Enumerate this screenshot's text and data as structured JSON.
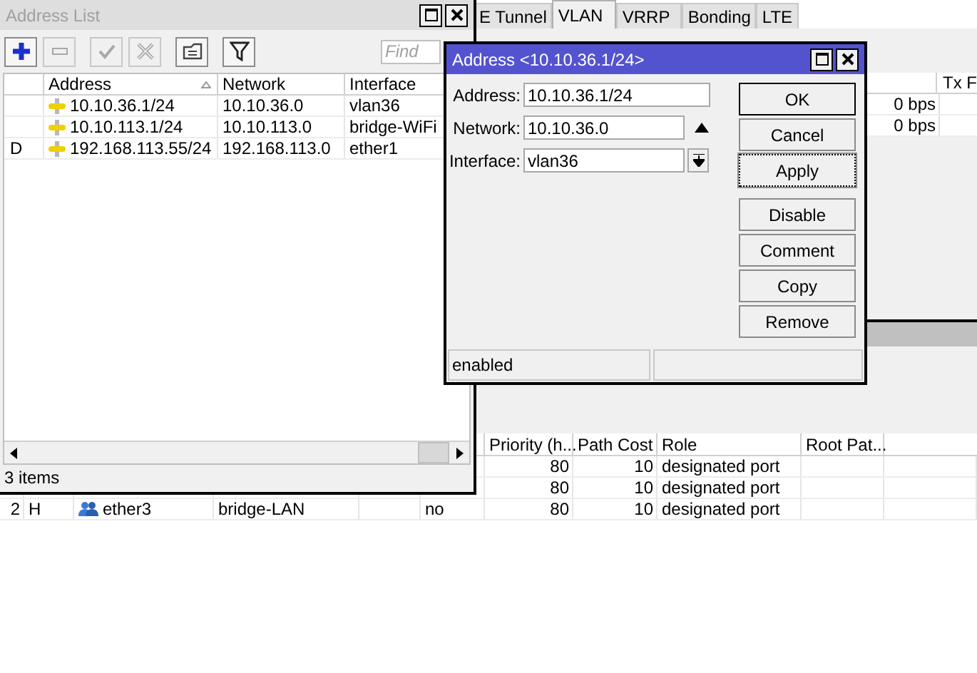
{
  "main_window": {
    "tabs": [
      {
        "label": "E Tunnel",
        "selected": false
      },
      {
        "label": "VLAN",
        "selected": true
      },
      {
        "label": "VRRP",
        "selected": false
      },
      {
        "label": "Bonding",
        "selected": false
      },
      {
        "label": "LTE",
        "selected": false
      }
    ],
    "upper_table": {
      "column": "Tx F",
      "rows": [
        {
          "rate": "0 bps"
        },
        {
          "rate": "0 bps"
        }
      ]
    },
    "lower_table": {
      "columns": [
        "Priority (h...",
        "Path Cost",
        "Role",
        "Root Pat..."
      ],
      "rows": [
        {
          "priority": "80",
          "path_cost": "10",
          "role": "designated port"
        },
        {
          "priority": "80",
          "path_cost": "10",
          "role": "designated port"
        },
        {
          "number": "2",
          "flag": "H",
          "interface": "ether3",
          "bridge": "bridge-LAN",
          "column_6": "no",
          "priority": "80",
          "path_cost": "10",
          "role": "designated port"
        }
      ]
    }
  },
  "address_list": {
    "title": "Address List",
    "active": false,
    "toolbar": [
      {
        "kind": "add",
        "disabled": false
      },
      {
        "kind": "remove",
        "disabled": true
      },
      {
        "kind": "enable",
        "disabled": true
      },
      {
        "kind": "disable",
        "disabled": true
      },
      {
        "kind": "comment",
        "disabled": false
      },
      {
        "kind": "filter",
        "disabled": false
      }
    ],
    "find": {
      "placeholder": "Find"
    },
    "columns": [
      {
        "label": "Address",
        "sorted": true
      },
      {
        "label": "Network",
        "sorted": false
      },
      {
        "label": "Interface",
        "sorted": false
      }
    ],
    "rows": [
      {
        "address": "10.10.36.1/24",
        "network": "10.10.36.0",
        "interface": "vlan36"
      },
      {
        "address": "10.10.113.1/24",
        "network": "10.10.113.0",
        "interface": "bridge-WiFi"
      },
      {
        "flag": "D",
        "address": "192.168.113.55/24",
        "network": "192.168.113.0",
        "interface": "ether1"
      }
    ],
    "status": "3 items"
  },
  "address_dialog": {
    "title": "Address <10.10.36.1/24>",
    "active": true,
    "fields": [
      {
        "label": "Address:",
        "value": "10.10.36.1/24",
        "kind": "text"
      },
      {
        "label": "Network:",
        "value": "10.10.36.0",
        "kind": "spin"
      },
      {
        "label": "Interface:",
        "value": "vlan36",
        "kind": "dropdown"
      }
    ],
    "buttons": [
      {
        "label": "OK",
        "focused": false
      },
      {
        "label": "Cancel",
        "focused": false
      },
      {
        "label": "Apply",
        "focused": true
      },
      {
        "label": "Disable",
        "focused": false
      },
      {
        "label": "Comment",
        "focused": false
      },
      {
        "label": "Copy",
        "focused": false
      },
      {
        "label": "Remove",
        "focused": false
      }
    ],
    "status": "enabled"
  }
}
